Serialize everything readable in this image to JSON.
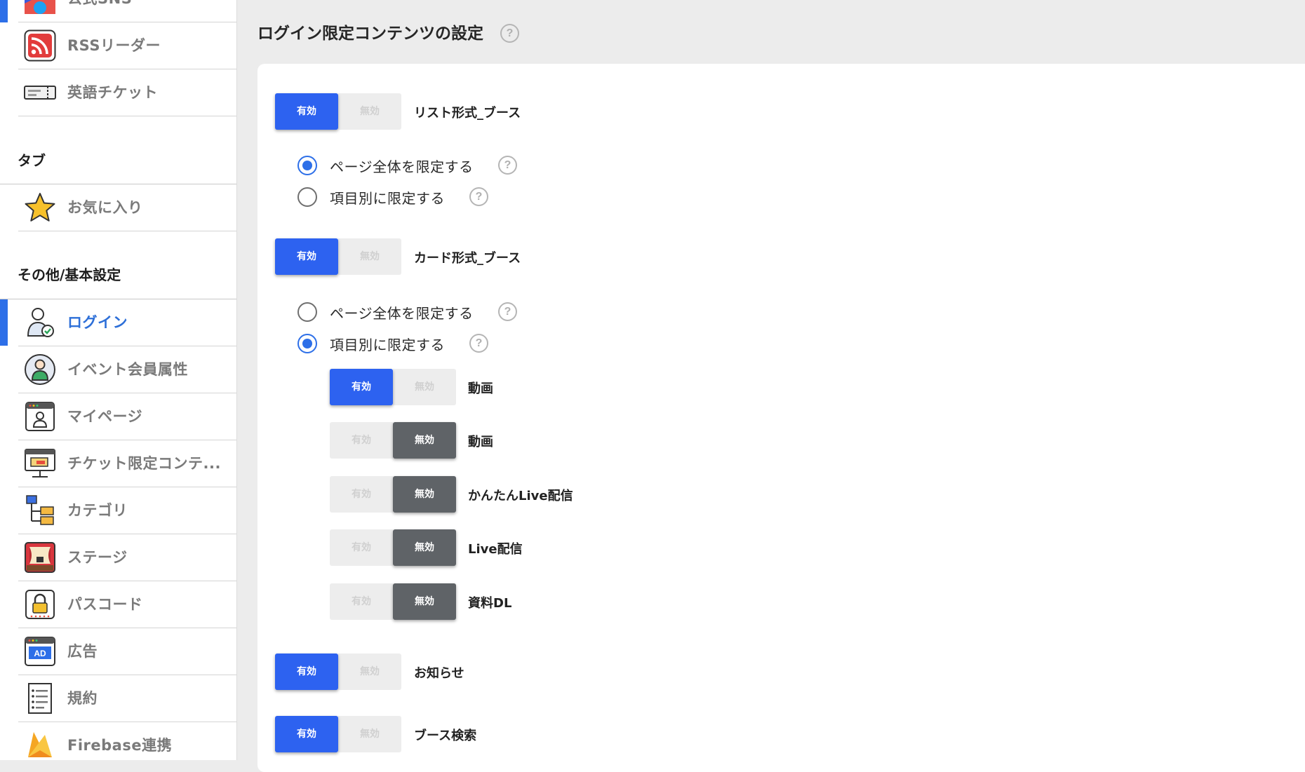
{
  "sidebar": {
    "items_top": [
      {
        "label": "公式SNS",
        "icon": "twitter-icon"
      },
      {
        "label": "RSSリーダー",
        "icon": "rss-icon"
      },
      {
        "label": "英語チケット",
        "icon": "ticket-icon"
      }
    ],
    "tab_heading": "タブ",
    "tab_items": [
      {
        "label": "お気に入り",
        "icon": "star-icon"
      }
    ],
    "other_heading": "その他/基本設定",
    "other_items": [
      {
        "label": "ログイン",
        "icon": "user-check-icon",
        "active": true
      },
      {
        "label": "イベント会員属性",
        "icon": "member-icon"
      },
      {
        "label": "マイページ",
        "icon": "mypage-icon"
      },
      {
        "label": "チケット限定コンテ...",
        "icon": "ticket-content-icon"
      },
      {
        "label": "カテゴリ",
        "icon": "category-icon"
      },
      {
        "label": "ステージ",
        "icon": "stage-icon"
      },
      {
        "label": "パスコード",
        "icon": "lock-icon"
      },
      {
        "label": "広告",
        "icon": "ad-icon"
      },
      {
        "label": "規約",
        "icon": "terms-icon"
      },
      {
        "label": "Firebase連携",
        "icon": "firebase-icon"
      }
    ],
    "accent": "#2d6fe8"
  },
  "main": {
    "title": "ログイン限定コンテンツの設定",
    "help_glyph": "?",
    "toggle_on_label": "有効",
    "toggle_off_label": "無効",
    "sections": [
      {
        "label": "リスト形式_ブース",
        "state": "on"
      },
      {
        "label": "カード形式_ブース",
        "state": "on"
      },
      {
        "label": "お知らせ",
        "state": "on"
      },
      {
        "label": "ブース検索",
        "state": "on"
      }
    ],
    "list_radio": {
      "options": [
        "ページ全体を限定する",
        "項目別に限定する"
      ],
      "selected": "ページ全体を限定する"
    },
    "card_radio": {
      "options": [
        "ページ全体を限定する",
        "項目別に限定する"
      ],
      "selected": "項目別に限定する"
    },
    "card_items": [
      {
        "label": "動画",
        "state": "on"
      },
      {
        "label": "動画",
        "state": "off"
      },
      {
        "label": "かんたんLive配信",
        "state": "off"
      },
      {
        "label": "Live配信",
        "state": "off"
      },
      {
        "label": "資料DL",
        "state": "off"
      }
    ],
    "colors": {
      "on": "#2d62f0",
      "off": "#5f6367",
      "idle": "#ededed"
    }
  }
}
